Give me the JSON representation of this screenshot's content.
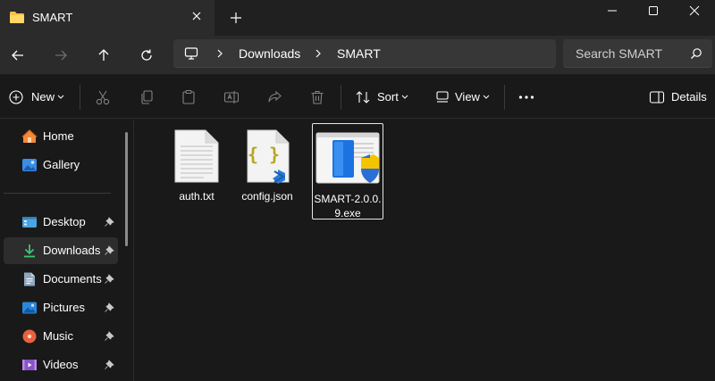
{
  "window": {
    "tab_title": "SMART"
  },
  "address": {
    "crumbs": [
      "Downloads",
      "SMART"
    ]
  },
  "search": {
    "placeholder": "Search SMART"
  },
  "toolbar": {
    "new_label": "New",
    "sort_label": "Sort",
    "view_label": "View",
    "details_label": "Details"
  },
  "sidebar": {
    "items": [
      {
        "label": "Home",
        "icon": "home-icon"
      },
      {
        "label": "Gallery",
        "icon": "gallery-icon"
      },
      {
        "label": "Desktop",
        "icon": "desktop-icon",
        "pinned": true
      },
      {
        "label": "Downloads",
        "icon": "downloads-icon",
        "pinned": true,
        "selected": true
      },
      {
        "label": "Documents",
        "icon": "documents-icon",
        "pinned": true
      },
      {
        "label": "Pictures",
        "icon": "pictures-icon",
        "pinned": true
      },
      {
        "label": "Music",
        "icon": "music-icon",
        "pinned": true
      },
      {
        "label": "Videos",
        "icon": "videos-icon",
        "pinned": true
      }
    ]
  },
  "files": [
    {
      "name": "auth.txt",
      "icon": "text-file-icon"
    },
    {
      "name": "config.json",
      "icon": "json-file-icon"
    },
    {
      "name": "SMART-2.0.0.9.exe",
      "icon": "installer-icon",
      "selected": true
    }
  ],
  "colors": {
    "background": "#191919",
    "chrome": "#202020",
    "panel": "#2b2b2b",
    "accent_blue": "#4cc2ff",
    "download_green": "#3ec56f"
  }
}
